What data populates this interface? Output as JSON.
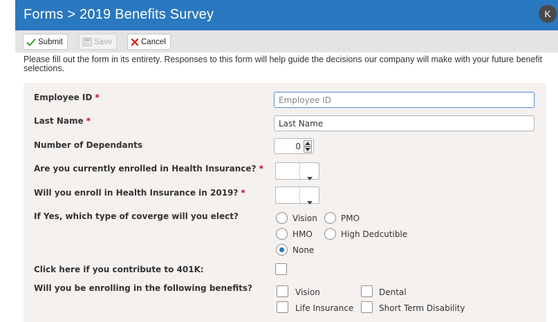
{
  "header": {
    "title": "Forms > 2019 Benefits Survey",
    "avatar_initial": "K"
  },
  "toolbar": {
    "submit_label": "Submit",
    "save_label": "Save",
    "cancel_label": "Cancel"
  },
  "intro_text": "Please fill out the form in its entirety. Responses to this form will help guide the decisions our company will make with your future benefit selections.",
  "colors": {
    "header_bg": "#2a78bf",
    "toolbar_bg": "#e4e4e4",
    "panel_bg": "#f4f1ef",
    "required": "#d0021b"
  },
  "form": {
    "employee_id": {
      "label": "Employee ID",
      "required_mark": "*",
      "placeholder": "Employee ID",
      "value": ""
    },
    "last_name": {
      "label": "Last Name",
      "required_mark": "*",
      "placeholder": "Last Name",
      "value": "Last Name"
    },
    "dependants": {
      "label": "Number of Dependants",
      "value": "0"
    },
    "health_enrolled": {
      "label": "Are you currently enrolled in Health Insurance?",
      "required_mark": "*",
      "value": ""
    },
    "health_2019": {
      "label": "Will you enroll in Health Insurance in 2019?",
      "required_mark": "*",
      "value": ""
    },
    "coverage": {
      "label": "If Yes, which type of coverge will you elect?",
      "options": [
        "Vision",
        "PMO",
        "HMO",
        "High Dedcutible",
        "None"
      ],
      "selected": "None"
    },
    "k401": {
      "label": "Click here if you contribute to 401K:",
      "checked": false
    },
    "benefits": {
      "label": "Will you be enrolling in the following benefits?",
      "options": [
        "Vision",
        "Dental",
        "Life Insurance",
        "Short Term Disability"
      ]
    }
  },
  "icons": {
    "submit": "checkmark-icon",
    "save": "save-icon",
    "cancel": "x-icon",
    "stepper_up": "caret-up-icon",
    "stepper_down": "caret-down-icon",
    "select": "chevron-down-icon"
  }
}
